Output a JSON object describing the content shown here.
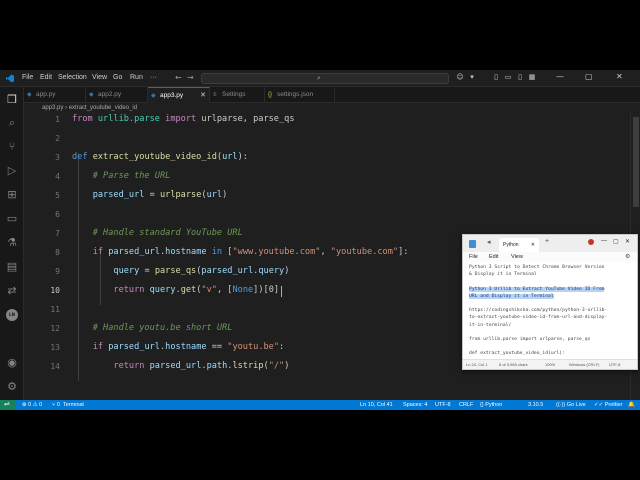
{
  "titlebar": {
    "menu": [
      "File",
      "Edit",
      "Selection",
      "View",
      "Go",
      "Run",
      "···"
    ],
    "search_placeholder": ""
  },
  "tabs": [
    {
      "label": "app.py",
      "active": false
    },
    {
      "label": "app2.py",
      "active": false
    },
    {
      "label": "app3.py",
      "active": true
    },
    {
      "label": "Settings",
      "active": false
    },
    {
      "label": "settings.json",
      "active": false
    }
  ],
  "breadcrumb": [
    "app3.py",
    "extract_youtube_video_id"
  ],
  "editor": {
    "line_numbers": [
      "1",
      "2",
      "3",
      "4",
      "5",
      "6",
      "7",
      "8",
      "9",
      "10",
      "11",
      "12",
      "13",
      "14"
    ],
    "current_line": "10",
    "lines": [
      [
        {
          "t": "from ",
          "c": "kw"
        },
        {
          "t": "urllib.parse ",
          "c": "cl"
        },
        {
          "t": "import ",
          "c": "kw"
        },
        {
          "t": "urlparse, parse_qs",
          "c": ""
        }
      ],
      [],
      [
        {
          "t": "def ",
          "c": "kwb"
        },
        {
          "t": "extract_youtube_video_id",
          "c": "fn"
        },
        {
          "t": "(",
          "c": ""
        },
        {
          "t": "url",
          "c": "vr"
        },
        {
          "t": "):",
          "c": ""
        }
      ],
      [
        {
          "t": "    # Parse the URL",
          "c": "cm"
        }
      ],
      [
        {
          "t": "    ",
          "c": ""
        },
        {
          "t": "parsed_url",
          "c": "vr"
        },
        {
          "t": " = ",
          "c": ""
        },
        {
          "t": "urlparse",
          "c": "fn"
        },
        {
          "t": "(",
          "c": ""
        },
        {
          "t": "url",
          "c": "vr"
        },
        {
          "t": ")",
          "c": ""
        }
      ],
      [],
      [
        {
          "t": "    # Handle standard YouTube URL",
          "c": "cm"
        }
      ],
      [
        {
          "t": "    ",
          "c": ""
        },
        {
          "t": "if ",
          "c": "kw"
        },
        {
          "t": "parsed_url",
          "c": "vr"
        },
        {
          "t": ".",
          "c": ""
        },
        {
          "t": "hostname",
          "c": "vr"
        },
        {
          "t": " in ",
          "c": "kwb"
        },
        {
          "t": "[",
          "c": ""
        },
        {
          "t": "\"www.youtube.com\"",
          "c": "st"
        },
        {
          "t": ", ",
          "c": ""
        },
        {
          "t": "\"youtube.com\"",
          "c": "st"
        },
        {
          "t": "]:",
          "c": ""
        }
      ],
      [
        {
          "t": "        ",
          "c": ""
        },
        {
          "t": "query",
          "c": "vr"
        },
        {
          "t": " = ",
          "c": ""
        },
        {
          "t": "parse_qs",
          "c": "fn"
        },
        {
          "t": "(",
          "c": ""
        },
        {
          "t": "parsed_url",
          "c": "vr"
        },
        {
          "t": ".",
          "c": ""
        },
        {
          "t": "query",
          "c": "vr"
        },
        {
          "t": ")",
          "c": ""
        }
      ],
      [
        {
          "t": "        ",
          "c": ""
        },
        {
          "t": "return ",
          "c": "kw"
        },
        {
          "t": "query",
          "c": "vr"
        },
        {
          "t": ".",
          "c": ""
        },
        {
          "t": "get",
          "c": "fn"
        },
        {
          "t": "(",
          "c": ""
        },
        {
          "t": "\"v\"",
          "c": "st"
        },
        {
          "t": ", [",
          "c": ""
        },
        {
          "t": "None",
          "c": "kwb"
        },
        {
          "t": "])[0]",
          "c": ""
        }
      ],
      [],
      [
        {
          "t": "    # Handle youtu.be short URL",
          "c": "cm"
        }
      ],
      [
        {
          "t": "    ",
          "c": ""
        },
        {
          "t": "if ",
          "c": "kw"
        },
        {
          "t": "parsed_url",
          "c": "vr"
        },
        {
          "t": ".",
          "c": ""
        },
        {
          "t": "hostname",
          "c": "vr"
        },
        {
          "t": " == ",
          "c": ""
        },
        {
          "t": "\"youtu.be\"",
          "c": "st"
        },
        {
          "t": ":",
          "c": ""
        }
      ],
      [
        {
          "t": "        ",
          "c": ""
        },
        {
          "t": "return ",
          "c": "kw"
        },
        {
          "t": "parsed_url",
          "c": "vr"
        },
        {
          "t": ".",
          "c": ""
        },
        {
          "t": "path",
          "c": "vr"
        },
        {
          "t": ".",
          "c": ""
        },
        {
          "t": "lstrip",
          "c": "fn"
        },
        {
          "t": "(",
          "c": ""
        },
        {
          "t": "\"/\"",
          "c": "st"
        },
        {
          "t": ")",
          "c": ""
        }
      ]
    ]
  },
  "statusbar": {
    "problems": "⊗ 0 ⚠ 0",
    "ports": "⑂ 0",
    "terminal": "Terminal",
    "position": "Ln 10, Col 41",
    "spaces": "Spaces: 4",
    "encoding": "UTF-8",
    "eol": "CRLF",
    "language": "{} Python",
    "version": "3.10.5",
    "golive": "Go Live",
    "prettier": "Prettier"
  },
  "notepad": {
    "tab_title": "Python",
    "menu": [
      "File",
      "Edit",
      "View"
    ],
    "lines": [
      "Python 3 Script to Detect Chrome Browser Version",
      "& Display it in Terminal",
      "",
      "Python 3 Urllib to Extract YouTube Video ID From",
      "URL and Display it in Terminal",
      "",
      "https://codingshiksha.com/python/python-3-urllib-",
      "to-extract-youtube-video-id-from-url-and-display-",
      "it-in-terminal/",
      "",
      "from urllib.parse import urlparse, parse_qs",
      "",
      "def extract_youtube_video_id(url):"
    ],
    "status": {
      "pos": "Ln 24, Col 1",
      "chars": "8 of 3,965 chars",
      "zoom": "100%",
      "eol": "Windows (CRLF)",
      "enc": "UTF-8"
    }
  },
  "colors": {
    "accent": "#0078d4",
    "editor_bg": "#1f1f1f",
    "remote": "#16825d"
  }
}
